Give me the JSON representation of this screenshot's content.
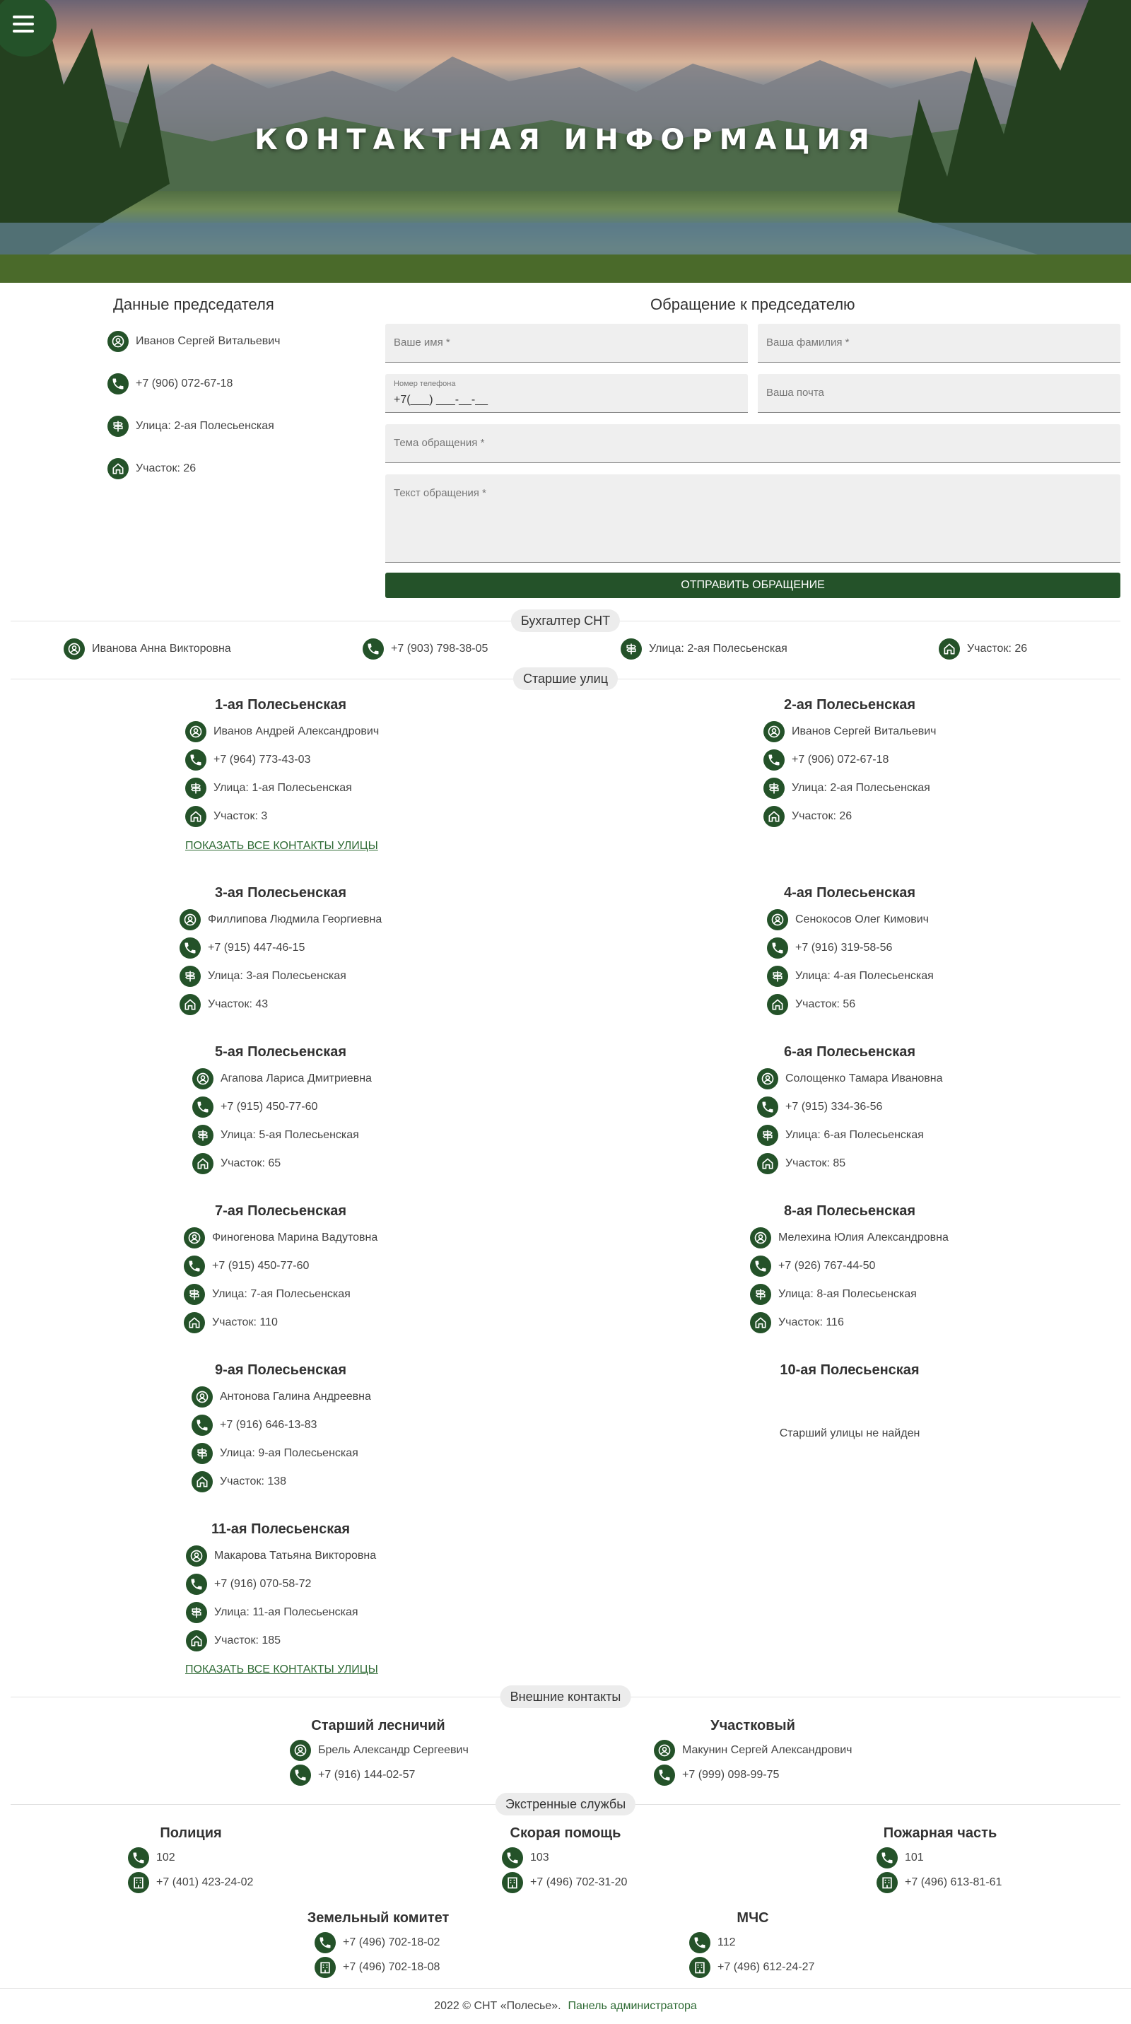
{
  "hero": {
    "title": "КОНТАКТНАЯ ИНФОРМАЦИЯ"
  },
  "chairman": {
    "title": "Данные председателя",
    "name": "Иванов Сергей Витальевич",
    "phone": "+7 (906) 072-67-18",
    "street": "Улица: 2-ая Полесьенская",
    "plot": "Участок: 26"
  },
  "form": {
    "title": "Обращение к председателю",
    "first_name_placeholder": "Ваше имя *",
    "last_name_placeholder": "Ваша фамилия *",
    "phone_label": "Номер телефона",
    "phone_value": "+7(___) ___-__-__",
    "email_placeholder": "Ваша почта",
    "subject_placeholder": "Тема обращения *",
    "message_placeholder": "Текст обращения *",
    "submit_label": "ОТПРАВИТЬ ОБРАЩЕНИЕ"
  },
  "accountant": {
    "chip": "Бухгалтер СНТ",
    "name": "Иванова Анна Викторовна",
    "phone": "+7 (903) 798-38-05",
    "street": "Улица: 2-ая Полесьенская",
    "plot": "Участок: 26"
  },
  "elders": {
    "chip": "Старшие улиц",
    "show_all": "ПОКАЗАТЬ ВСЕ КОНТАКТЫ УЛИЦЫ",
    "not_found": "Старший улицы не найден",
    "streets": [
      {
        "title": "1-ая Полесьенская",
        "name": "Иванов Андрей Александрович",
        "phone": "+7 (964) 773-43-03",
        "street": "Улица: 1-ая Полесьенская",
        "plot": "Участок: 3"
      },
      {
        "title": "2-ая Полесьенская",
        "name": "Иванов Сергей Витальевич",
        "phone": "+7 (906) 072-67-18",
        "street": "Улица: 2-ая Полесьенская",
        "plot": "Участок: 26"
      },
      {
        "title": "3-ая Полесьенская",
        "name": "Филлипова Людмила Георгиевна",
        "phone": "+7 (915) 447-46-15",
        "street": "Улица: 3-ая Полесьенская",
        "plot": "Участок: 43"
      },
      {
        "title": "4-ая Полесьенская",
        "name": "Сенокосов Олег Кимович",
        "phone": "+7 (916) 319-58-56",
        "street": "Улица: 4-ая Полесьенская",
        "plot": "Участок: 56"
      },
      {
        "title": "5-ая Полесьенская",
        "name": "Агапова Лариса Дмитриевна",
        "phone": "+7 (915) 450-77-60",
        "street": "Улица: 5-ая Полесьенская",
        "plot": "Участок: 65"
      },
      {
        "title": "6-ая Полесьенская",
        "name": "Солощенко Тамара Ивановна",
        "phone": "+7 (915) 334-36-56",
        "street": "Улица: 6-ая Полесьенская",
        "plot": "Участок: 85"
      },
      {
        "title": "7-ая Полесьенская",
        "name": "Финогенова Марина Вадутовна",
        "phone": "+7 (915) 450-77-60",
        "street": "Улица: 7-ая Полесьенская",
        "plot": "Участок: 110"
      },
      {
        "title": "8-ая Полесьенская",
        "name": "Мелехина Юлия Александровна",
        "phone": "+7 (926) 767-44-50",
        "street": "Улица: 8-ая Полесьенская",
        "plot": "Участок: 116"
      },
      {
        "title": "9-ая Полесьенская",
        "name": "Антонова Галина Андреевна",
        "phone": "+7 (916) 646-13-83",
        "street": "Улица: 9-ая Полесьенская",
        "plot": "Участок: 138"
      },
      {
        "title": "10-ая Полесьенская"
      },
      {
        "title": "11-ая Полесьенская",
        "name": "Макарова Татьяна Викторовна",
        "phone": "+7 (916) 070-58-72",
        "street": "Улица: 11-ая Полесьенская",
        "plot": "Участок: 185"
      }
    ]
  },
  "external": {
    "chip": "Внешние контакты",
    "contacts": [
      {
        "title": "Старший лесничий",
        "name": "Брель Александр Сергеевич",
        "phone": "+7 (916) 144-02-57"
      },
      {
        "title": "Участковый",
        "name": "Макунин Сергей Александрович",
        "phone": "+7 (999) 098-99-75"
      }
    ]
  },
  "emergency": {
    "chip": "Экстренные службы",
    "services": [
      {
        "title": "Полиция",
        "short": "102",
        "phone": "+7 (401) 423-24-02"
      },
      {
        "title": "Скорая помощь",
        "short": "103",
        "phone": "+7 (496) 702-31-20"
      },
      {
        "title": "Пожарная часть",
        "short": "101",
        "phone": "+7 (496) 613-81-61"
      },
      {
        "title": "Земельный комитет",
        "short": "+7 (496) 702-18-02",
        "phone": "+7 (496) 702-18-08"
      },
      {
        "title": "МЧС",
        "short": "112",
        "phone": "+7 (496) 612-24-27"
      }
    ]
  },
  "footer": {
    "copyright": "2022 © СНТ «Полесье».",
    "admin_link": "Панель администратора"
  },
  "colors": {
    "accent": "#245229",
    "link": "#2e6a34",
    "chip_bg": "#ececec"
  }
}
